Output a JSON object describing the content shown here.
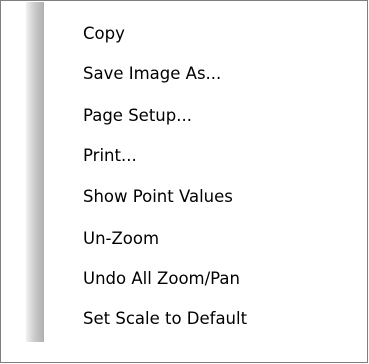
{
  "context_menu": {
    "items": [
      {
        "label": "Copy"
      },
      {
        "label": "Save Image As..."
      },
      {
        "label": "Page Setup..."
      },
      {
        "label": "Print..."
      },
      {
        "label": "Show Point Values"
      },
      {
        "label": "Un-Zoom"
      },
      {
        "label": "Undo All Zoom/Pan"
      },
      {
        "label": "Set Scale to Default"
      }
    ]
  }
}
